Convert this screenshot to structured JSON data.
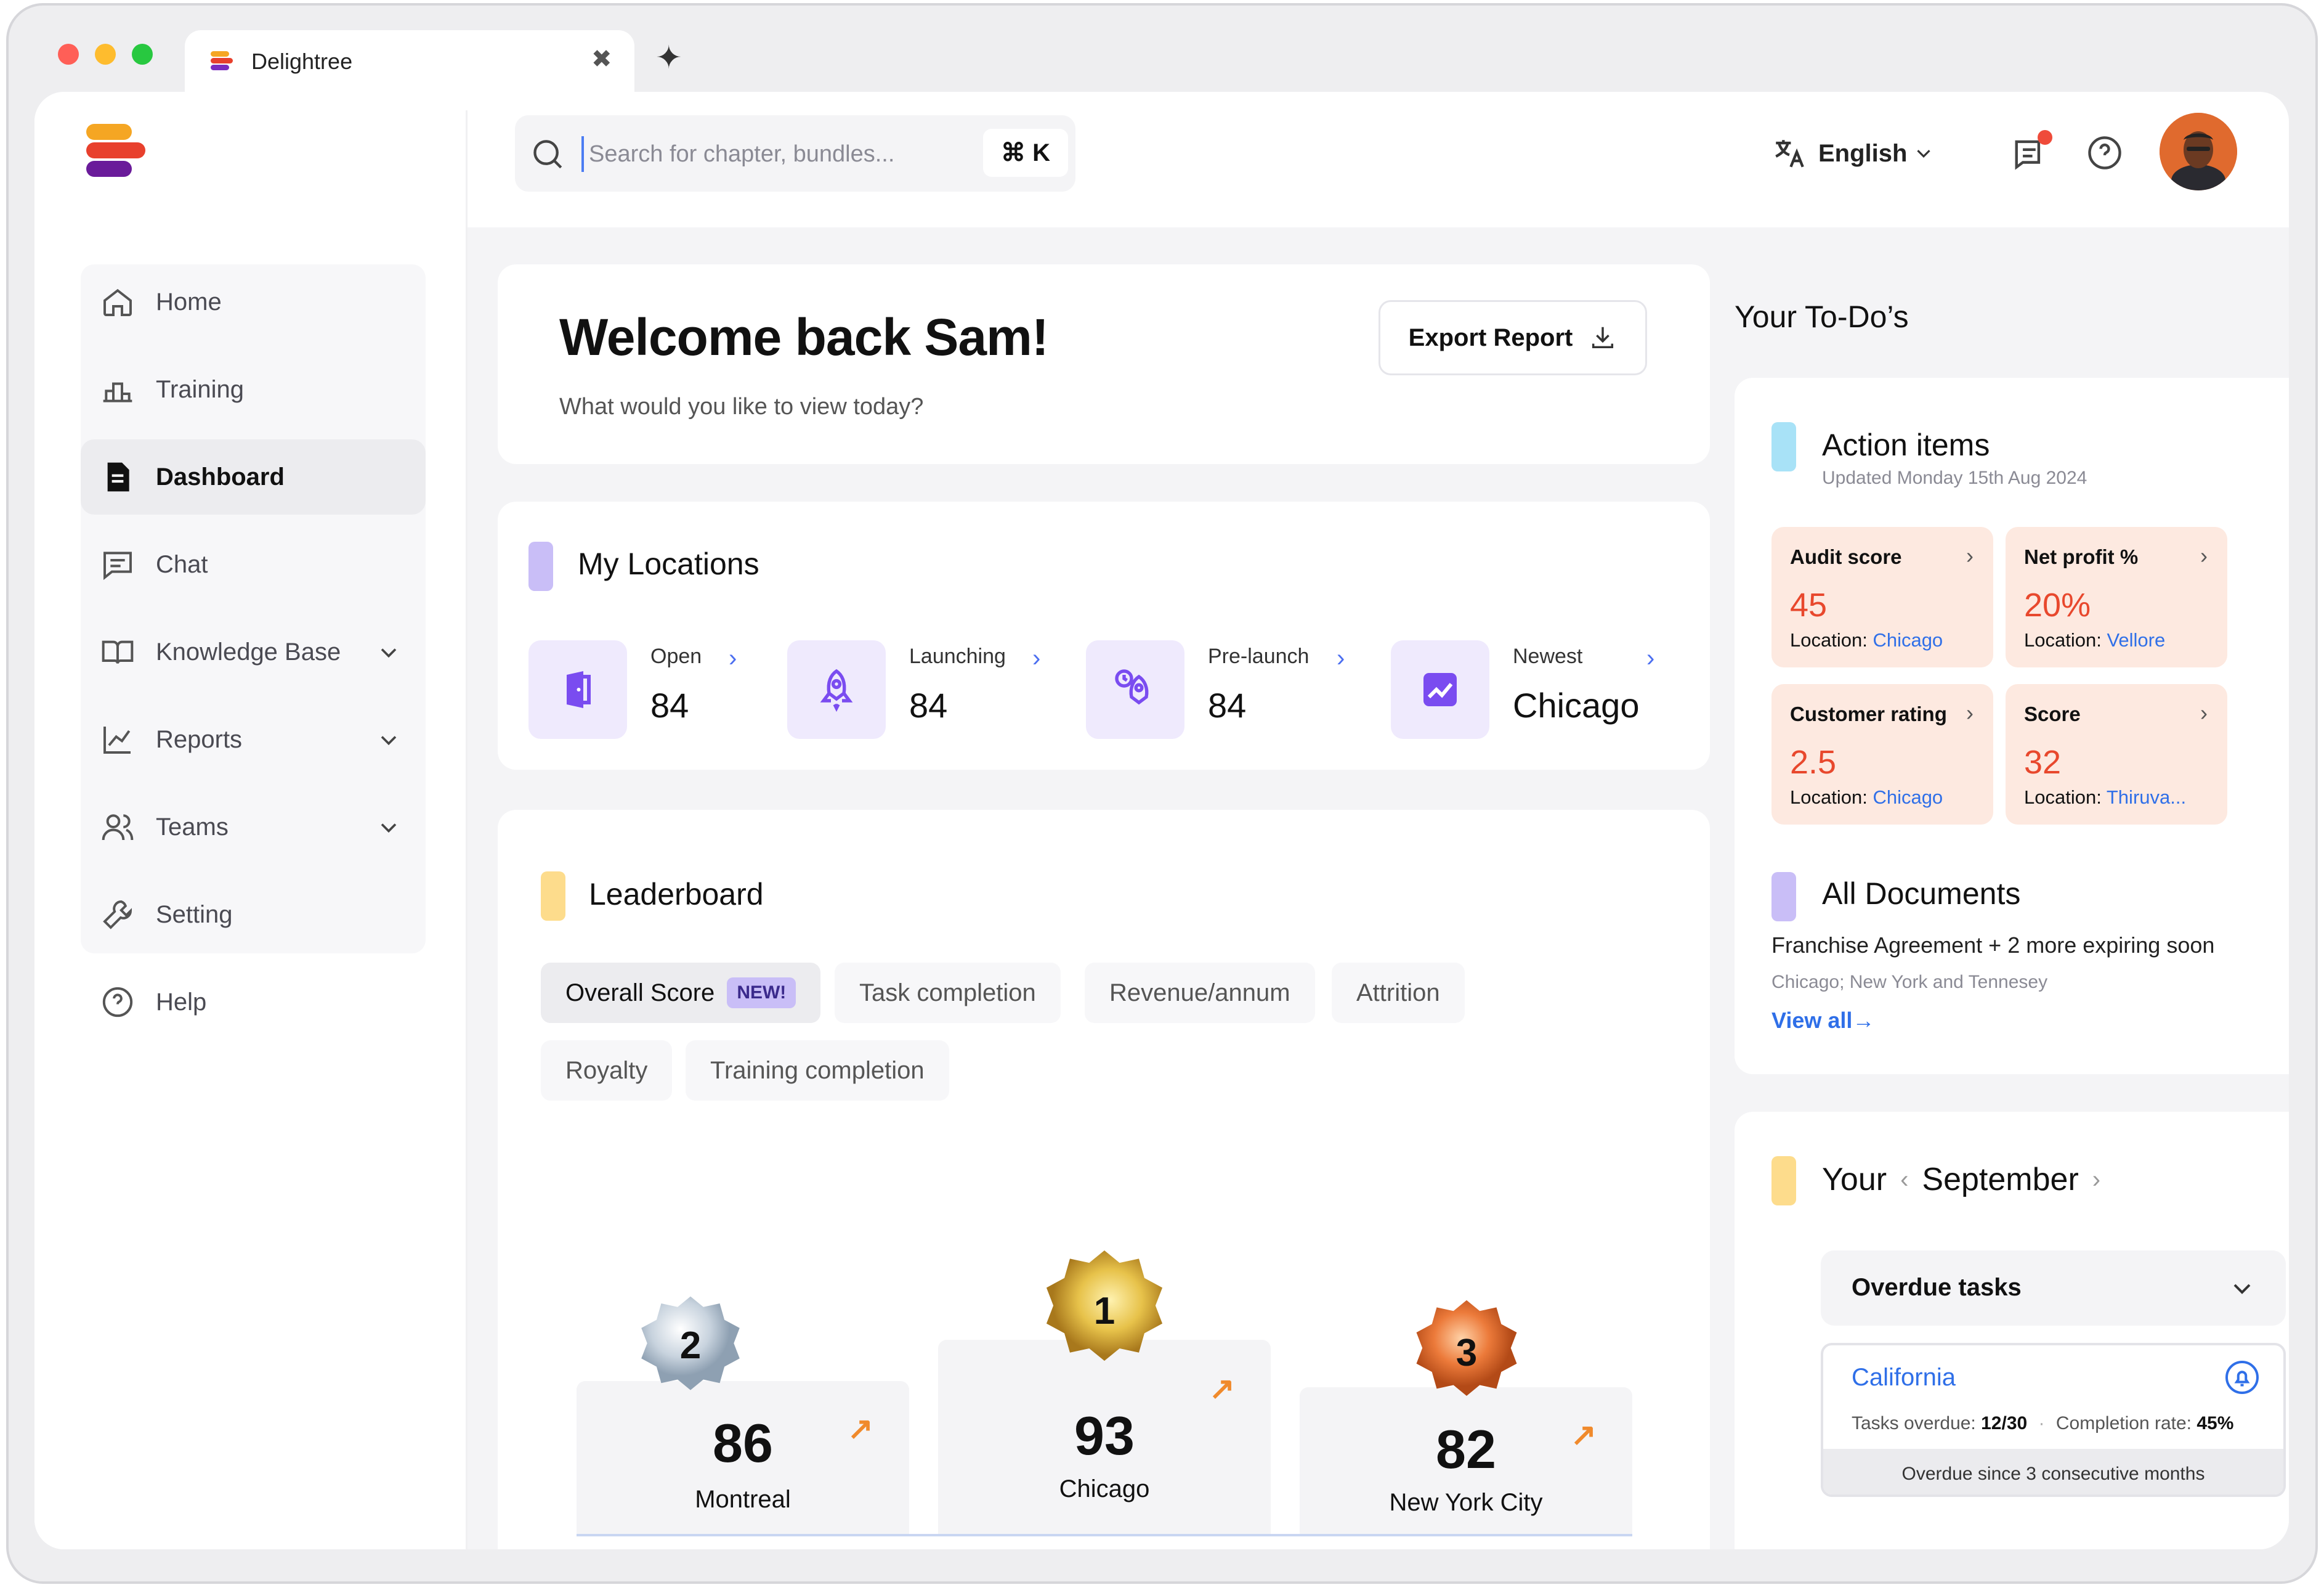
{
  "browser": {
    "tab_title": "Delightree",
    "tab_close": "✖",
    "new_tab": "✦",
    "traffic_colors": [
      "#ff5f57",
      "#febc2e",
      "#28c840"
    ]
  },
  "header": {
    "search_placeholder": "Search for chapter, bundles...",
    "search_shortcut": "⌘ K",
    "language": "English"
  },
  "sidebar": {
    "items": [
      {
        "label": "Home"
      },
      {
        "label": "Training"
      },
      {
        "label": "Dashboard"
      },
      {
        "label": "Chat"
      },
      {
        "label": "Knowledge Base"
      },
      {
        "label": "Reports"
      },
      {
        "label": "Teams"
      },
      {
        "label": "Setting"
      },
      {
        "label": "Help"
      }
    ],
    "active": "Dashboard"
  },
  "welcome": {
    "title": "Welcome back Sam!",
    "subtitle": "What would you like to view today?",
    "export_label": "Export Report"
  },
  "locations": {
    "title": "My Locations",
    "items": [
      {
        "label": "Open",
        "value": "84"
      },
      {
        "label": "Launching",
        "value": "84"
      },
      {
        "label": "Pre-launch",
        "value": "84"
      },
      {
        "label": "Newest",
        "value": "Chicago"
      }
    ],
    "chevron": "›"
  },
  "leaderboard": {
    "title": "Leaderboard",
    "tabs": [
      "Overall Score",
      "Task completion",
      "Revenue/annum",
      "Attrition",
      "Royalty",
      "Training completion"
    ],
    "new_badge": "NEW!",
    "podium": [
      {
        "rank": "2",
        "score": "86",
        "city": "Montreal"
      },
      {
        "rank": "1",
        "score": "93",
        "city": "Chicago"
      },
      {
        "rank": "3",
        "score": "82",
        "city": "New York City"
      }
    ],
    "trend_arrow": "↗"
  },
  "todos": {
    "title": "Your To-Do’s",
    "action_items": {
      "title": "Action items",
      "updated": "Updated Monday 15th Aug 2024",
      "location_prefix": "Location: ",
      "chevron": "›",
      "cards": [
        {
          "title": "Audit score",
          "value": "45",
          "location": "Chicago"
        },
        {
          "title": "Net profit %",
          "value": "20%",
          "location": "Vellore"
        },
        {
          "title": "Customer rating",
          "value": "2.5",
          "location": "Chicago"
        },
        {
          "title": "Score",
          "value": "32",
          "location": "Thiruva..."
        }
      ]
    },
    "documents": {
      "title": "All Documents",
      "line": "Franchise Agreement + 2 more expiring soon",
      "places": "Chicago; New York and Tennesey",
      "link": "View all→"
    },
    "month": {
      "prefix": "Your",
      "prev": "‹",
      "month": "September",
      "next": "›",
      "overdue_title": "Overdue tasks",
      "card": {
        "location": "California",
        "tasks_label": "Tasks overdue:",
        "tasks_value": "12/30",
        "dot": "·",
        "rate_label": "Completion rate:",
        "rate_value": "45%",
        "footer": "Overdue since 3 consecutive months"
      }
    }
  }
}
